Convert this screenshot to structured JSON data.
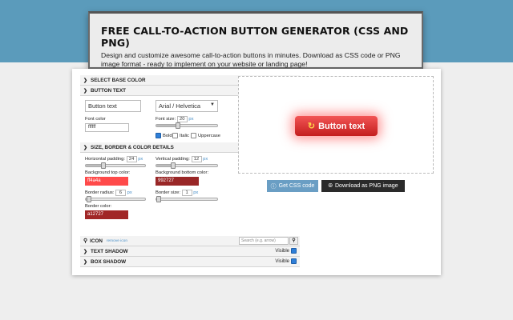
{
  "header": {
    "title": "FREE CALL-TO-ACTION BUTTON GENERATOR (CSS AND PNG)",
    "description": "Design and customize awesome call-to-action buttons in minutes. Download as CSS code or PNG image format - ready to implement on your website or landing page!"
  },
  "base_color": {
    "label": "SELECT BASE COLOR",
    "value": "b32e2e",
    "color": "#b32e2e"
  },
  "button_text": {
    "label": "BUTTON TEXT",
    "text_value": "Button text",
    "font_value": "Arial / Helvetica",
    "font_color_label": "Font color",
    "font_color_value": "ffffff",
    "font_size_label": "Font size:",
    "font_size_value": "20",
    "unit": "px",
    "font_size_fraction": 0.35,
    "bold_label": "Bold",
    "bold_checked": true,
    "italic_label": "Italic",
    "italic_checked": false,
    "uppercase_label": "Uppercase",
    "uppercase_checked": false
  },
  "size": {
    "label": "SIZE, BORDER & COLOR DETAILS",
    "hpad_label": "Horizontal padding:",
    "hpad_value": "24",
    "hpad_fraction": 0.3,
    "vpad_label": "Vertical padding:",
    "vpad_value": "12",
    "vpad_fraction": 0.28,
    "bg_top_label": "Background top color:",
    "bg_top_value": "ff4a4a",
    "bg_top_color": "#ff4a4a",
    "bg_bottom_label": "Background bottom color:",
    "bg_bottom_value": "992727",
    "bg_bottom_color": "#992727",
    "radius_label": "Border radius:",
    "radius_value": "6",
    "radius_fraction": 0.05,
    "bsize_label": "Border size:",
    "bsize_value": "1",
    "bsize_fraction": 0.02,
    "bcolor_label": "Border color:",
    "bcolor_value": "a12727",
    "bcolor_color": "#a12727"
  },
  "icon": {
    "label": "ICON",
    "remove_label": "remove icon",
    "search_placeholder": "Search (e.g. arrow)"
  },
  "text_shadow": {
    "label": "TEXT SHADOW",
    "visible_label": "Visible",
    "checked": true
  },
  "box_shadow": {
    "label": "BOX SHADOW",
    "visible_label": "Visible",
    "checked": true
  },
  "preview": {
    "button_label": "Button text",
    "icon_glyph": "↻"
  },
  "actions": {
    "css_label": "Get CSS code",
    "png_label": "Download as PNG image"
  }
}
